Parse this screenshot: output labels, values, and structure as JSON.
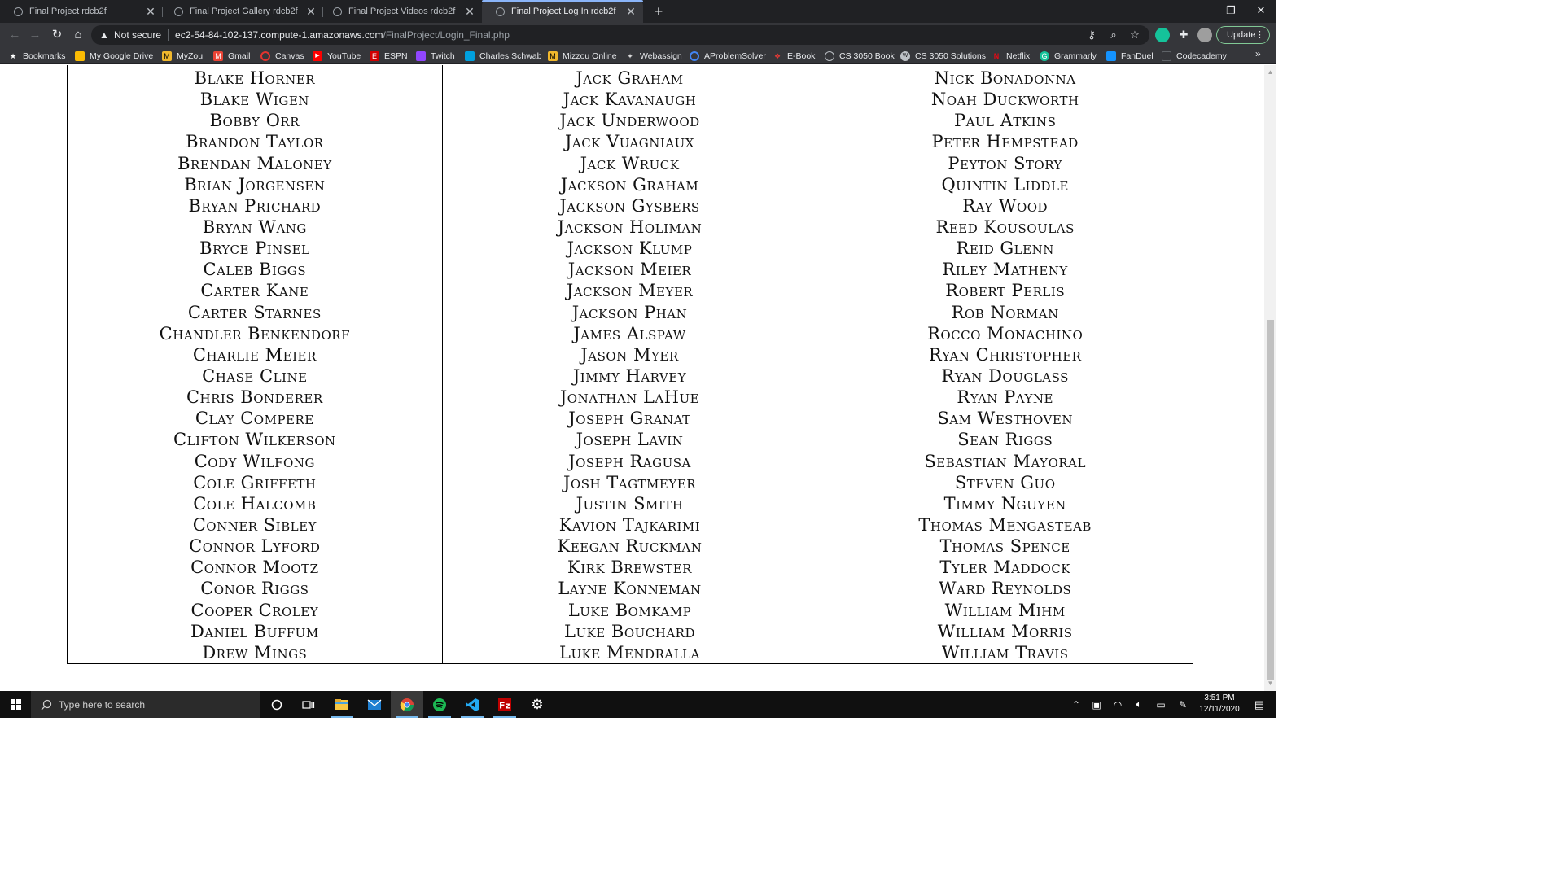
{
  "browser": {
    "tabs": [
      {
        "title": "Final Project rdcb2f",
        "active": false
      },
      {
        "title": "Final Project Gallery rdcb2f",
        "active": false
      },
      {
        "title": "Final Project Videos rdcb2f",
        "active": false
      },
      {
        "title": "Final Project Log In rdcb2f",
        "active": true
      }
    ],
    "security_label": "Not secure",
    "url_host": "ec2-54-84-102-137.compute-1.amazonaws.com",
    "url_path": "/FinalProject/Login_Final.php",
    "update_label": "Update",
    "bookmarks": [
      {
        "label": "Bookmarks",
        "icon": "star-icon",
        "color": "#e8eaed"
      },
      {
        "label": "My Google Drive",
        "icon": "google-drive-icon",
        "color": "#fbbc04"
      },
      {
        "label": "MyZou",
        "icon": "myzou-icon",
        "color": "#f1b82d"
      },
      {
        "label": "Gmail",
        "icon": "gmail-icon",
        "color": "#ea4335"
      },
      {
        "label": "Canvas",
        "icon": "canvas-icon",
        "color": "#e3342f"
      },
      {
        "label": "YouTube",
        "icon": "youtube-icon",
        "color": "#ff0000"
      },
      {
        "label": "ESPN",
        "icon": "espn-icon",
        "color": "#d00000"
      },
      {
        "label": "Twitch",
        "icon": "twitch-icon",
        "color": "#9146ff"
      },
      {
        "label": "Charles Schwab",
        "icon": "schwab-icon",
        "color": "#00a0df"
      },
      {
        "label": "Mizzou Online",
        "icon": "mizzou-icon",
        "color": "#f1b82d"
      },
      {
        "label": "Webassign",
        "icon": "webassign-icon",
        "color": "#d9d9d9"
      },
      {
        "label": "AProblemSolver",
        "icon": "aproblemsolver-icon",
        "color": "#4285f4"
      },
      {
        "label": "E-Book",
        "icon": "ebook-icon",
        "color": "#e53935"
      },
      {
        "label": "CS 3050 Book",
        "icon": "globe-icon",
        "color": "#bdc1c6"
      },
      {
        "label": "CS 3050 Solutions",
        "icon": "wl-icon",
        "color": "#bdc1c6"
      },
      {
        "label": "Netflix",
        "icon": "netflix-icon",
        "color": "#e50914"
      },
      {
        "label": "Grammarly",
        "icon": "grammarly-icon",
        "color": "#15c39a"
      },
      {
        "label": "FanDuel",
        "icon": "fanduel-icon",
        "color": "#1493ff"
      },
      {
        "label": "Codecademy",
        "icon": "codecademy-icon",
        "color": "#3a4a5c"
      }
    ]
  },
  "page": {
    "columns": [
      [
        "Blake Horner",
        "Blake Wigen",
        "Bobby Orr",
        "Brandon Taylor",
        "Brendan Maloney",
        "Brian Jorgensen",
        "Bryan Prichard",
        "Bryan Wang",
        "Bryce Pinsel",
        "Caleb Biggs",
        "Carter Kane",
        "Carter Starnes",
        "Chandler Benkendorf",
        "Charlie Meier",
        "Chase Cline",
        "Chris Bonderer",
        "Clay Compere",
        "Clifton Wilkerson",
        "Cody Wilfong",
        "Cole Griffeth",
        "Cole Halcomb",
        "Conner Sibley",
        "Connor Lyford",
        "Connor Mootz",
        "Conor Riggs",
        "Cooper Croley",
        "Daniel Buffum",
        "Drew Mings"
      ],
      [
        "Jack Graham",
        "Jack Kavanaugh",
        "Jack Underwood",
        "Jack Vuagniaux",
        "Jack Wruck",
        "Jackson Graham",
        "Jackson Gysbers",
        "Jackson Holiman",
        "Jackson Klump",
        "Jackson Meier",
        "Jackson Meyer",
        "Jackson Phan",
        "James Alspaw",
        "Jason Myer",
        "Jimmy Harvey",
        "Jonathan LaHue",
        "Joseph Granat",
        "Joseph Lavin",
        "Joseph Ragusa",
        "Josh Tagtmeyer",
        "Justin Smith",
        "Kavion Tajkarimi",
        "Keegan Ruckman",
        "Kirk Brewster",
        "Layne Konneman",
        "Luke Bomkamp",
        "Luke Bouchard",
        "Luke Mendralla"
      ],
      [
        "Nick Bonadonna",
        "Noah Duckworth",
        "Paul Atkins",
        "Peter Hempstead",
        "Peyton Story",
        "Quintin Liddle",
        "Ray Wood",
        "Reed Kousoulas",
        "Reid Glenn",
        "Riley Matheny",
        "Robert Perlis",
        "Rob Norman",
        "Rocco Monachino",
        "Ryan Christopher",
        "Ryan Douglass",
        "Ryan Payne",
        "Sam Westhoven",
        "Sean Riggs",
        "Sebastian Mayoral",
        "Steven Guo",
        "Timmy Nguyen",
        "Thomas Mengasteab",
        "Thomas Spence",
        "Tyler Maddock",
        "Ward Reynolds",
        "William Mihm",
        "William Morris",
        "William Travis"
      ]
    ]
  },
  "taskbar": {
    "search_placeholder": "Type here to search",
    "time": "3:51 PM",
    "date": "12/11/2020",
    "apps": [
      "cortana-icon",
      "task-view-icon",
      "file-explorer-icon",
      "mail-icon",
      "chrome-icon",
      "spotify-icon",
      "vscode-icon",
      "filezilla-icon",
      "settings-icon"
    ]
  }
}
